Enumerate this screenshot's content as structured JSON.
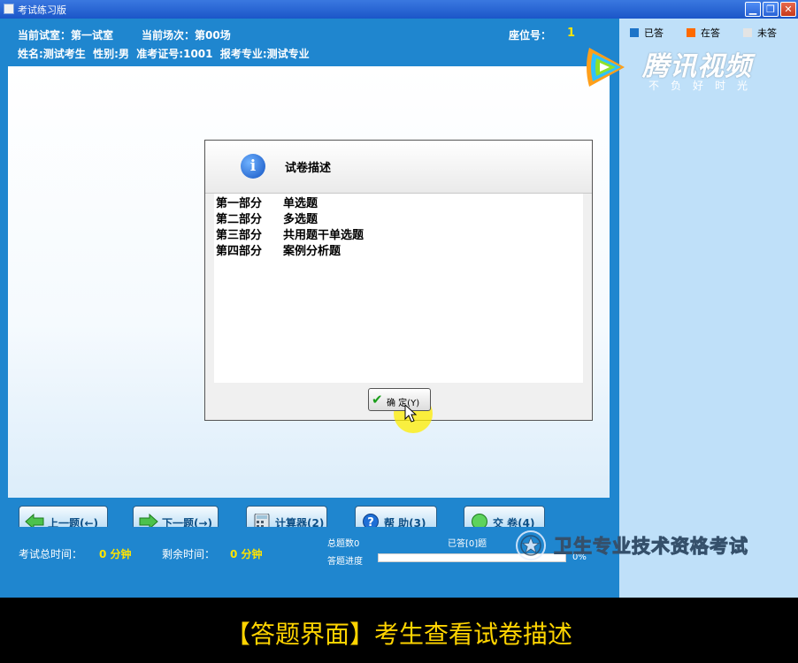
{
  "window": {
    "title": "考试练习版",
    "min_icon": "minimize-icon",
    "max_icon": "maximize-icon",
    "close_icon": "close-icon"
  },
  "header": {
    "room_label": "当前试室：第一试室",
    "session_label": "当前场次：第00场",
    "seat_label": "座位号：",
    "seat_value": "1",
    "candidate_info": "姓名:测试考生  性别:男  准考证号:1001  报考专业:测试专业"
  },
  "legend": [
    {
      "label": "已答",
      "color": "#1d74c8"
    },
    {
      "label": "在答",
      "color": "#ff6a00"
    },
    {
      "label": "未答",
      "color": "#e4e4e4"
    }
  ],
  "watermark": {
    "brand": "腾讯视频",
    "slogan": "不负好时光"
  },
  "dialog": {
    "title": "试卷描述",
    "parts": [
      {
        "name": "第一部分",
        "type": "单选题"
      },
      {
        "name": "第二部分",
        "type": "多选题"
      },
      {
        "name": "第三部分",
        "type": "共用题干单选题"
      },
      {
        "name": "第四部分",
        "type": "案例分析题"
      }
    ],
    "ok_label": "确 定(Y)"
  },
  "nav": {
    "prev": "上一题(←)",
    "next": "下一题(→)",
    "calc": "计算器(2)",
    "help": "帮 助(3)",
    "submit": "交 卷(4)"
  },
  "footer": {
    "total_time_label": "考试总时间：",
    "total_time_value": "0 分钟",
    "remaining_label": "剩余时间：",
    "remaining_value": "0 分钟",
    "total_questions": "总题数0",
    "answered": "已答[0]题",
    "progress_label": "答题进度",
    "progress_percent": "0%",
    "progress_fraction": 0
  },
  "site_watermark": "卫生专业技术资格考试",
  "caption": "【答题界面】考生查看试卷描述"
}
